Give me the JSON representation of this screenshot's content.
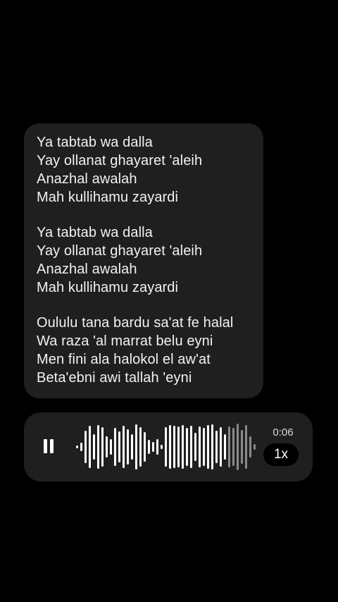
{
  "message": {
    "stanzas": [
      [
        "Ya tabtab wa dalla",
        "Yay ollanat ghayaret 'aleih",
        "Anazhal awalah",
        "Mah kullihamu zayardi"
      ],
      [
        "Ya tabtab wa dalla",
        "Yay ollanat ghayaret 'aleih",
        "Anazhal awalah",
        "Mah kullihamu zayardi"
      ],
      [
        "Oululu tana bardu sa'at fe halal",
        "Wa raza 'al marrat belu eyni",
        "Men fini ala halokol el aw'at",
        "Beta'ebni awi tallah 'eyni"
      ]
    ]
  },
  "voice_note": {
    "play_state_icon": "pause-icon",
    "duration": "0:06",
    "speed": "1x",
    "progress": 0.83,
    "colors": {
      "played": "#ffffff",
      "unplayed": "#8a8a8a"
    }
  }
}
